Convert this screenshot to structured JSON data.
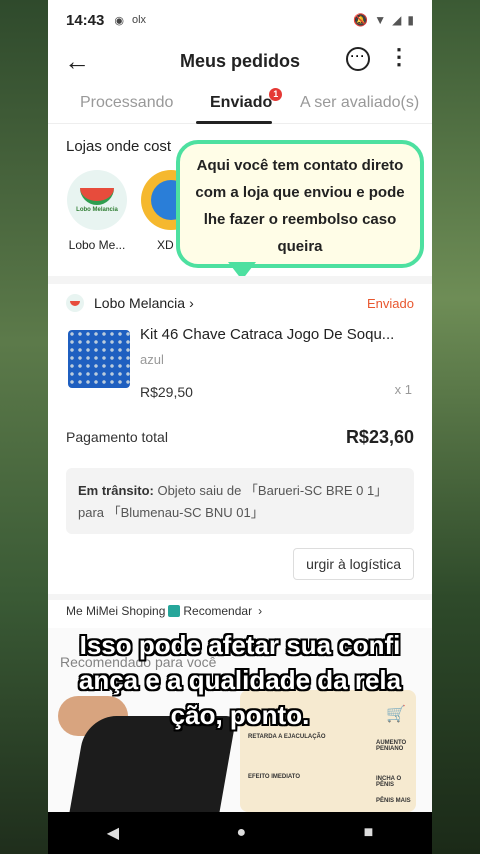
{
  "status_bar": {
    "time": "14:43",
    "icons": [
      "◉",
      "olx"
    ],
    "right_icons": [
      "🔕",
      "▼",
      "◢",
      "▮"
    ]
  },
  "header": {
    "back_glyph": "←",
    "title": "Meus pedidos",
    "chat_glyph": "···",
    "more_glyph": "⋮"
  },
  "tabs": [
    {
      "label": "Processando"
    },
    {
      "label": "Enviado",
      "badge": "1"
    },
    {
      "label": "A ser avaliado(s)"
    }
  ],
  "stores": {
    "title": "Lojas onde cost",
    "items": [
      {
        "name": "Lobo Me...",
        "logo_text": "Lobo Melancia"
      },
      {
        "name": "XD S"
      }
    ]
  },
  "tooltip": {
    "text": "Aqui você tem contato direto com a loja que enviou e pode lhe fazer o reembolso caso queira"
  },
  "order": {
    "shop_name": "Lobo Melancia",
    "shop_chevron": "›",
    "status": "Enviado",
    "product_name": "Kit 46 Chave Catraca Jogo De Soqu...",
    "variant": "azul",
    "price": "R$29,50",
    "qty": "x 1",
    "total_label": "Pagamento total",
    "total_value": "R$23,60",
    "transit_label": "Em trânsito:",
    "transit_text": "Objeto saiu de 「Barueri-SC BRE 0 1」 para 「Blumenau-SC BNU 01」",
    "urge_button": "urgir à logística"
  },
  "recommend": {
    "row_prefix": "Me MiMei Shoping",
    "row_link": "Recomendar",
    "row_chevron": "›",
    "title": "Recomendado para você",
    "tube_labels": [
      "RETARDA A EJACULAÇÃO",
      "EFEITO IMEDIATO",
      "AUMENTO PENIANO",
      "INCHA O PÊNIS",
      "PÊNIS MAIS"
    ]
  },
  "caption": {
    "line1": "Isso pode afetar sua confi",
    "line2": "ança e a qualidade da rela",
    "line3": "ção, ponto."
  },
  "navbar": {
    "back": "◀",
    "home": "●",
    "recent": "■"
  },
  "colors": {
    "accent_green": "#4de0a0",
    "status_orange": "#e8572f",
    "badge_red": "#e53935"
  }
}
